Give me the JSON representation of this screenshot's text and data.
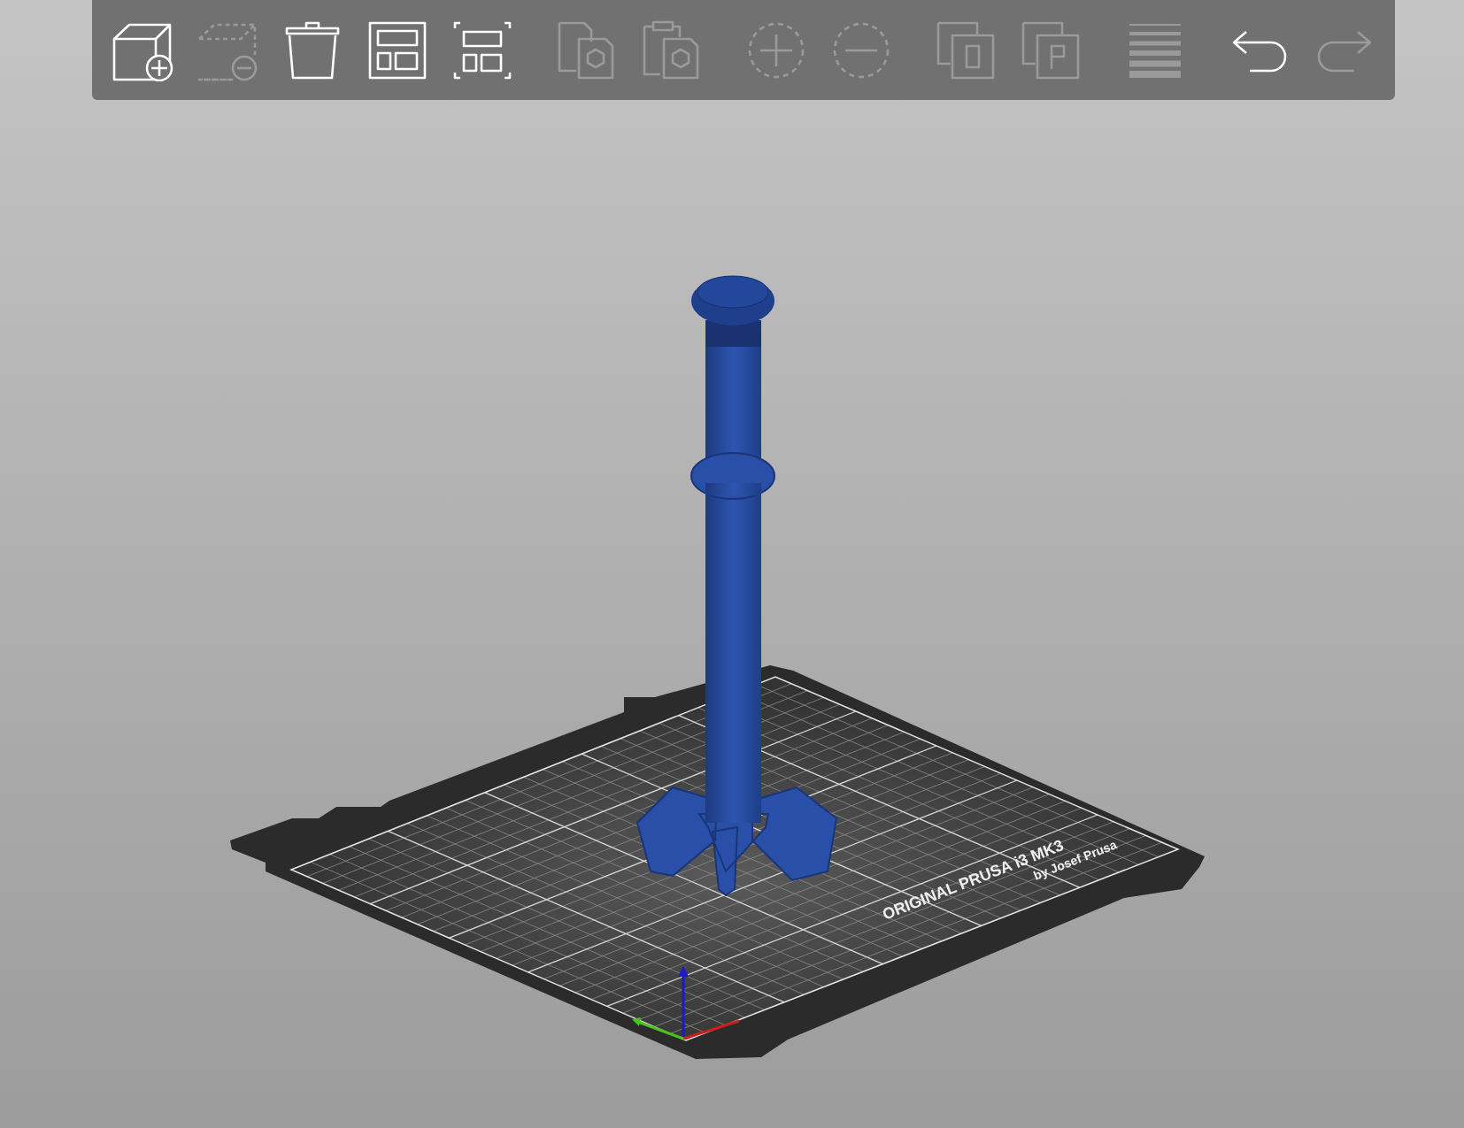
{
  "toolbar": {
    "tools": [
      {
        "kind": "add",
        "disabled": false
      },
      {
        "kind": "delete",
        "disabled": true
      },
      {
        "kind": "delete_all",
        "disabled": false
      },
      {
        "kind": "arrange",
        "disabled": false
      },
      {
        "kind": "arrange_selection",
        "disabled": false
      },
      {
        "kind": "copy",
        "disabled": true
      },
      {
        "kind": "paste",
        "disabled": true
      },
      {
        "kind": "add_instance",
        "disabled": true
      },
      {
        "kind": "remove_instance",
        "disabled": true
      },
      {
        "kind": "split_objects",
        "disabled": true
      },
      {
        "kind": "split_parts",
        "disabled": true
      },
      {
        "kind": "layers",
        "disabled": true
      },
      {
        "kind": "undo",
        "disabled": false
      },
      {
        "kind": "redo",
        "disabled": true
      }
    ]
  },
  "bed": {
    "brand": "ORIGINAL PRUSA i3 MK3",
    "maker": "by Josef Prusa"
  }
}
